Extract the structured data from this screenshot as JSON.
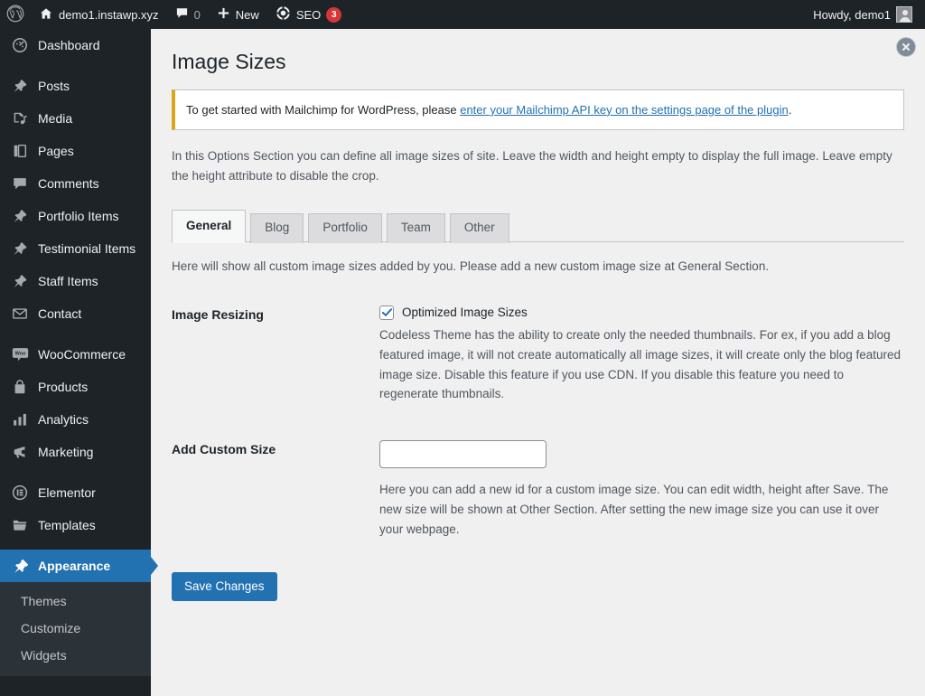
{
  "adminbar": {
    "logo_icon": "wordpress-logo-icon",
    "site_icon": "home-icon",
    "site_name": "demo1.instawp.xyz",
    "comments_icon": "comment-bubble-icon",
    "comments_count": "0",
    "new_icon": "plus-icon",
    "new_label": "New",
    "seo_icon": "gear-icon",
    "seo_label": "SEO",
    "seo_badge": "3",
    "howdy": "Howdy, demo1",
    "avatar_icon": "avatar-icon"
  },
  "sidebar": {
    "items": [
      {
        "label": "Dashboard",
        "icon": "dashboard-icon",
        "gap_after": true
      },
      {
        "label": "Posts",
        "icon": "pin-icon"
      },
      {
        "label": "Media",
        "icon": "media-icon"
      },
      {
        "label": "Pages",
        "icon": "pages-icon"
      },
      {
        "label": "Comments",
        "icon": "comment-bubble-icon"
      },
      {
        "label": "Portfolio Items",
        "icon": "pin-icon"
      },
      {
        "label": "Testimonial Items",
        "icon": "pin-icon"
      },
      {
        "label": "Staff Items",
        "icon": "pin-icon"
      },
      {
        "label": "Contact",
        "icon": "envelope-icon",
        "gap_after": true
      },
      {
        "label": "WooCommerce",
        "icon": "woocommerce-icon"
      },
      {
        "label": "Products",
        "icon": "products-bag-icon"
      },
      {
        "label": "Analytics",
        "icon": "bar-chart-icon"
      },
      {
        "label": "Marketing",
        "icon": "megaphone-icon",
        "gap_after": true
      },
      {
        "label": "Elementor",
        "icon": "elementor-icon"
      },
      {
        "label": "Templates",
        "icon": "folder-icon",
        "gap_after": true
      },
      {
        "label": "Appearance",
        "icon": "paintbrush-icon",
        "current": true
      }
    ],
    "submenu": [
      {
        "label": "Themes"
      },
      {
        "label": "Customize"
      },
      {
        "label": "Widgets"
      }
    ]
  },
  "content": {
    "close_icon": "close-circle-icon",
    "page_title": "Image Sizes",
    "notice": {
      "text_before": "To get started with Mailchimp for WordPress, please ",
      "link_text": "enter your Mailchimp API key on the settings page of the plugin",
      "text_after": "."
    },
    "intro": "In this Options Section you can define all image sizes of site. Leave the width and height empty to display the full image. Leave empty the height attribute to disable the crop.",
    "tabs": [
      {
        "label": "General",
        "active": true
      },
      {
        "label": "Blog",
        "active": false
      },
      {
        "label": "Portfolio",
        "active": false
      },
      {
        "label": "Team",
        "active": false
      },
      {
        "label": "Other",
        "active": false
      }
    ],
    "tab_description": "Here will show all custom image sizes added by you. Please add a new custom image size at General Section.",
    "image_resizing": {
      "label": "Image Resizing",
      "checkbox_label": "Optimized Image Sizes",
      "checkbox_checked": true,
      "description": "Codeless Theme has the ability to create only the needed thumbnails. For ex, if you add a blog featured image, it will not create automatically all image sizes, it will create only the blog featured image size. Disable this feature if you use CDN. If you disable this feature you need to regenerate thumbnails."
    },
    "add_custom_size": {
      "label": "Add Custom Size",
      "input_value": "",
      "input_placeholder": "",
      "description": "Here you can add a new id for a custom image size. You can edit width, height after Save. The new size will be shown at Other Section. After setting the new image size you can use it over your webpage."
    },
    "save_button": "Save Changes"
  },
  "colors": {
    "adminbar_bg": "#1d2327",
    "sidebar_bg": "#1d2327",
    "submenu_bg": "#2c3338",
    "accent_blue": "#2271b1",
    "link_blue": "#2271b1",
    "notice_border": "#dba617",
    "badge_red": "#d63638",
    "content_bg": "#f0f0f1"
  }
}
